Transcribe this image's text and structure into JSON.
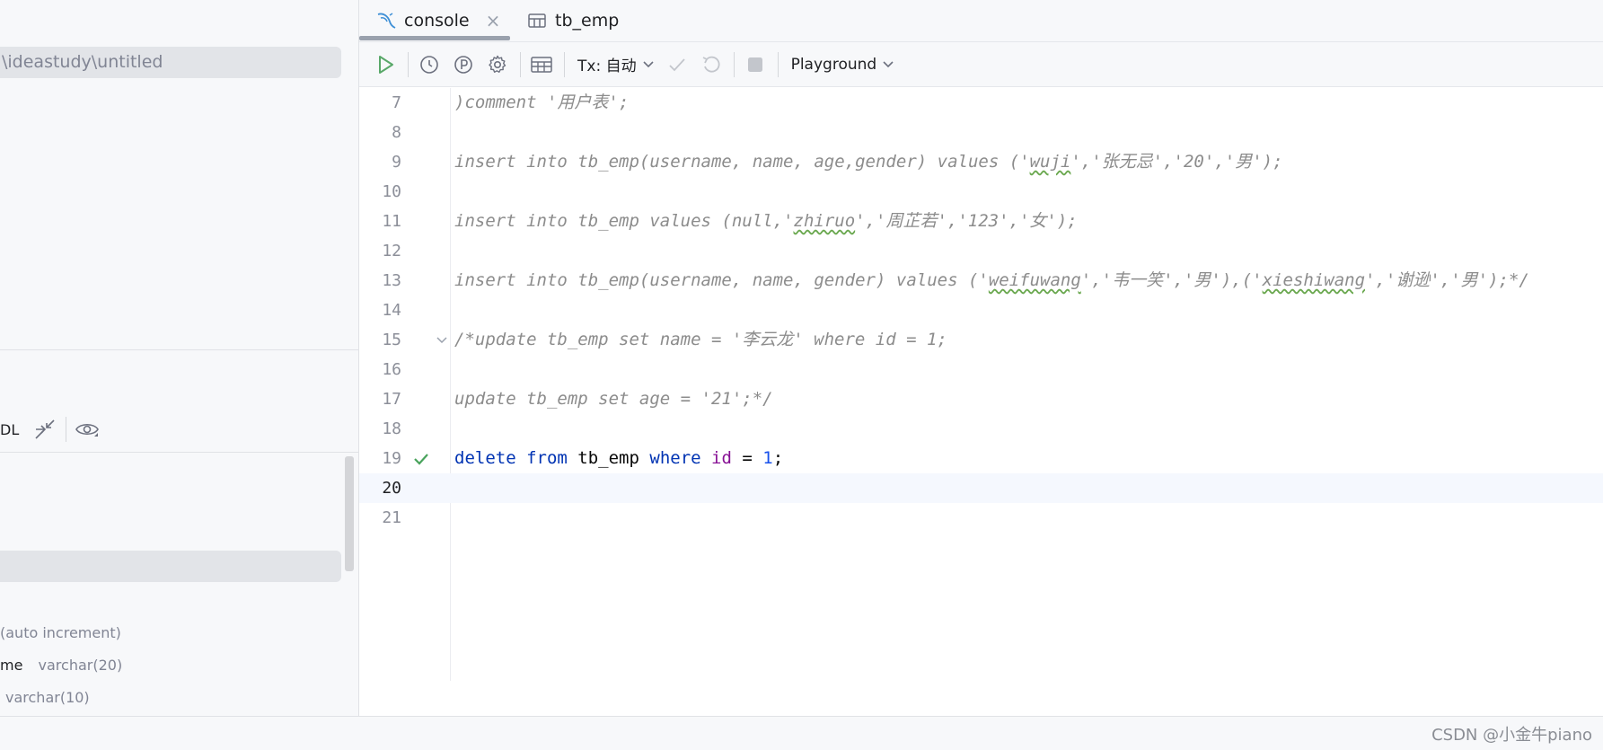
{
  "sidebar": {
    "path_text": "\\ideastudy\\untitled",
    "ddl_label": "DL",
    "columns": [
      {
        "name": "",
        "type": "(auto increment)"
      },
      {
        "name": "me",
        "type": "varchar(20)"
      },
      {
        "name": "",
        "type": "varchar(10)"
      }
    ]
  },
  "tabs": [
    {
      "label": "console",
      "icon": "mysql-console-icon",
      "close": "×"
    },
    {
      "label": "tb_emp",
      "icon": "table-icon"
    }
  ],
  "toolbar": {
    "tx_label": "Tx: 自动",
    "playground_label": "Playground"
  },
  "editor": {
    "current_line": "20",
    "lines": [
      {
        "num": "7",
        "tokens": [
          {
            "t": ")comment '用户表';",
            "c": "comment"
          }
        ]
      },
      {
        "num": "8",
        "tokens": []
      },
      {
        "num": "9",
        "tokens": [
          {
            "t": "insert into tb_emp(username, name, age,gender) values ('",
            "c": "comment"
          },
          {
            "t": "wuji",
            "c": "comment squiggle"
          },
          {
            "t": "','张无忌','20','男');",
            "c": "comment"
          }
        ]
      },
      {
        "num": "10",
        "tokens": []
      },
      {
        "num": "11",
        "tokens": [
          {
            "t": "insert into tb_emp values (null,'",
            "c": "comment"
          },
          {
            "t": "zhiruo",
            "c": "comment squiggle"
          },
          {
            "t": "','周芷若','123','女');",
            "c": "comment"
          }
        ]
      },
      {
        "num": "12",
        "tokens": []
      },
      {
        "num": "13",
        "tokens": [
          {
            "t": "insert into tb_emp(username, name, gender) values ('",
            "c": "comment"
          },
          {
            "t": "weifuwang",
            "c": "comment squiggle"
          },
          {
            "t": "','韦一笑','男'),('",
            "c": "comment"
          },
          {
            "t": "xieshiwang",
            "c": "comment squiggle"
          },
          {
            "t": "','谢逊','男');*/",
            "c": "comment"
          }
        ]
      },
      {
        "num": "14",
        "tokens": []
      },
      {
        "num": "15",
        "tokens": [
          {
            "t": "/*update tb_emp set name = '李云龙' where id = 1;",
            "c": "comment"
          }
        ],
        "fold": true
      },
      {
        "num": "16",
        "tokens": []
      },
      {
        "num": "17",
        "tokens": [
          {
            "t": "update tb_emp set age = '21';*/",
            "c": "comment"
          }
        ]
      },
      {
        "num": "18",
        "tokens": []
      },
      {
        "num": "19",
        "tokens": [
          {
            "t": "delete",
            "c": "kw"
          },
          {
            "t": " ",
            "c": "ident"
          },
          {
            "t": "from",
            "c": "kw"
          },
          {
            "t": " tb_emp ",
            "c": "ident"
          },
          {
            "t": "where",
            "c": "kw"
          },
          {
            "t": " ",
            "c": "ident"
          },
          {
            "t": "id",
            "c": "field"
          },
          {
            "t": " = ",
            "c": "ident"
          },
          {
            "t": "1",
            "c": "num"
          },
          {
            "t": ";",
            "c": "ident"
          }
        ],
        "check": true
      },
      {
        "num": "20",
        "tokens": []
      },
      {
        "num": "21",
        "tokens": []
      }
    ]
  },
  "watermark": "CSDN @小金牛piano",
  "colors": {
    "run_green": "#59a869",
    "check_green": "#49a35c",
    "keyword": "#0033b3",
    "comment": "#8c8c8c",
    "number": "#1750eb",
    "field": "#871094"
  }
}
